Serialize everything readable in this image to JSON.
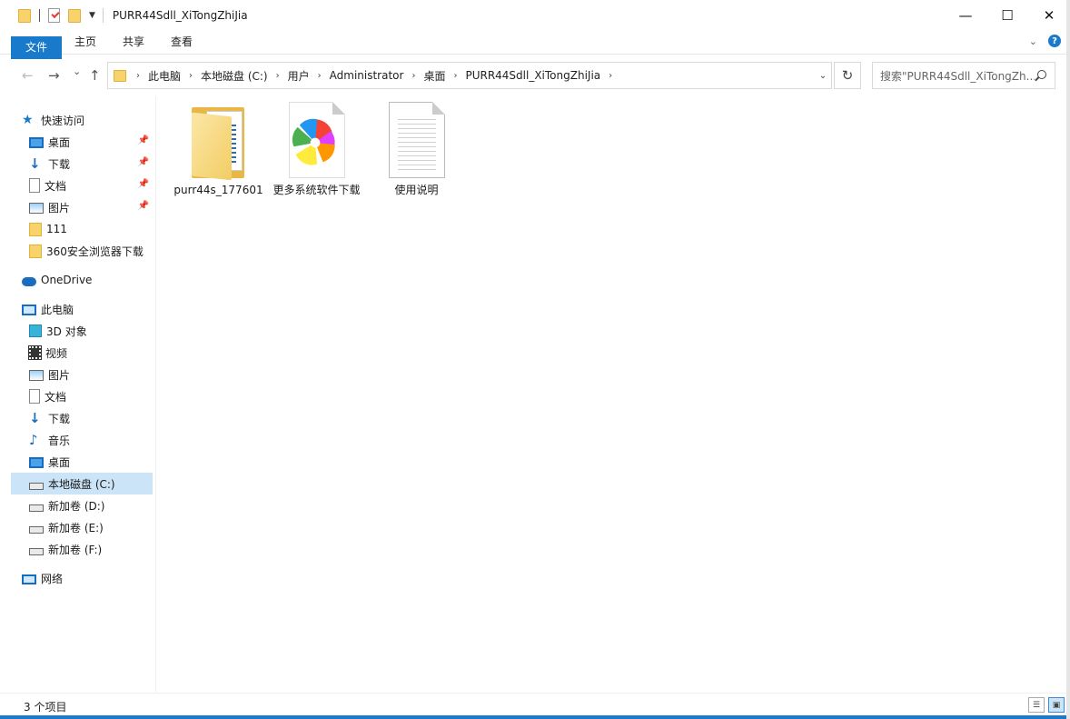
{
  "window": {
    "title": "PURR44Sdll_XiTongZhiJia",
    "min_symbol": "—",
    "max_symbol": "☐",
    "close_symbol": "✕"
  },
  "ribbon": {
    "tabs": [
      "文件",
      "主页",
      "共享",
      "查看"
    ],
    "help_symbol": "?"
  },
  "nav": {
    "back": "←",
    "forward": "→",
    "recent": "⌄",
    "up": "↑",
    "refresh": "↻",
    "dropdown": "⌄"
  },
  "address": {
    "crumbs": [
      "此电脑",
      "本地磁盘 (C:)",
      "用户",
      "Administrator",
      "桌面",
      "PURR44Sdll_XiTongZhiJia"
    ],
    "separator": "›"
  },
  "search": {
    "placeholder": "搜索\"PURR44Sdll_XiTongZh..."
  },
  "sidebar": {
    "quick_access": "快速访问",
    "quick_items": [
      "桌面",
      "下载",
      "文档",
      "图片",
      "111",
      "360安全浏览器下载"
    ],
    "onedrive": "OneDrive",
    "this_pc": "此电脑",
    "pc_items": [
      "3D 对象",
      "视频",
      "图片",
      "文档",
      "下载",
      "音乐",
      "桌面",
      "本地磁盘 (C:)",
      "新加卷 (D:)",
      "新加卷 (E:)",
      "新加卷 (F:)"
    ],
    "network": "网络"
  },
  "files": [
    {
      "name": "purr44s_177601",
      "icon": "folder-icon"
    },
    {
      "name": "更多系统软件下载",
      "icon": "pinwheel-shortcut-icon"
    },
    {
      "name": "使用说明",
      "icon": "text-document-icon"
    }
  ],
  "status": {
    "item_count": "3 个项目"
  },
  "colors": {
    "accent": "#1979ca",
    "selected": "#cce4f7",
    "folder": "#f8d26a"
  }
}
